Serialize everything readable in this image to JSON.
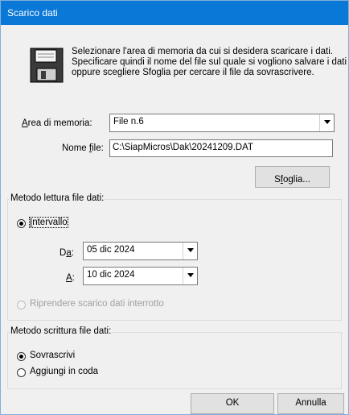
{
  "window": {
    "title": "Scarico dati"
  },
  "info": {
    "lines": [
      "Selezionare l'area di memoria da cui si desidera scaricare i dati.",
      "Specificare quindi il nome del file sul quale si vogliono salvare i dati",
      "oppure scegliere Sfoglia per cercare il file da sovrascrivere."
    ],
    "icon": "floppy-disk-icon"
  },
  "area": {
    "label_pre": "A",
    "label_post": "rea di memoria:",
    "value": "File n.6"
  },
  "file": {
    "label_pre": "Nome ",
    "label_u": "f",
    "label_post": "ile:",
    "value": "C:\\SiapMicros\\Dak\\20241209.DAT"
  },
  "browse": {
    "label_pre": "S",
    "label_u": "f",
    "label_post": "oglia..."
  },
  "read_method": {
    "legend": "Metodo lettura file dati:",
    "interval_u": "I",
    "interval_rest": "ntervallo",
    "interval_selected": true,
    "from_label_pre": "D",
    "from_label_u": "a",
    "from_label_post": ":",
    "from_value": "05  dic  2024",
    "to_label_u": "A",
    "to_label_post": ":",
    "to_value": "10  dic  2024",
    "resume_label": "Riprendere scarico dati interrotto",
    "resume_enabled": false
  },
  "write_method": {
    "legend": "Metodo scrittura file dati:",
    "overwrite_label": "Sovrascrivi",
    "overwrite_selected": true,
    "append_label": "Aggiungi in coda",
    "append_selected": false
  },
  "buttons": {
    "ok": "OK",
    "cancel": "Annulla"
  }
}
